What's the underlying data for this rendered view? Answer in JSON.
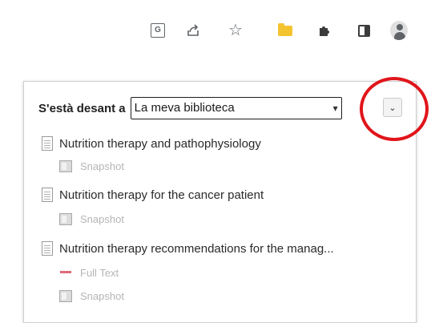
{
  "toolbar": {
    "icons": [
      "translate-icon",
      "share-icon",
      "star-icon",
      "zotero-folder-icon",
      "extensions-icon",
      "side-panel-icon",
      "profile-icon"
    ],
    "translate_glyph": "G"
  },
  "popup": {
    "save_label": "S'està desant a",
    "library_select": {
      "value": "La meva biblioteca",
      "caret": "▾"
    },
    "toggle_glyph": "⌄",
    "highlight_color": "#e0151b"
  },
  "items": [
    {
      "title": "Nutrition therapy and pathophysiology",
      "attachments": [
        {
          "type": "snapshot",
          "label": "Snapshot"
        }
      ]
    },
    {
      "title": "Nutrition therapy for the cancer patient",
      "attachments": [
        {
          "type": "snapshot",
          "label": "Snapshot"
        }
      ]
    },
    {
      "title": "Nutrition therapy recommendations for the manag...",
      "attachments": [
        {
          "type": "pdf",
          "label": "Full Text"
        },
        {
          "type": "snapshot",
          "label": "Snapshot"
        }
      ]
    }
  ]
}
